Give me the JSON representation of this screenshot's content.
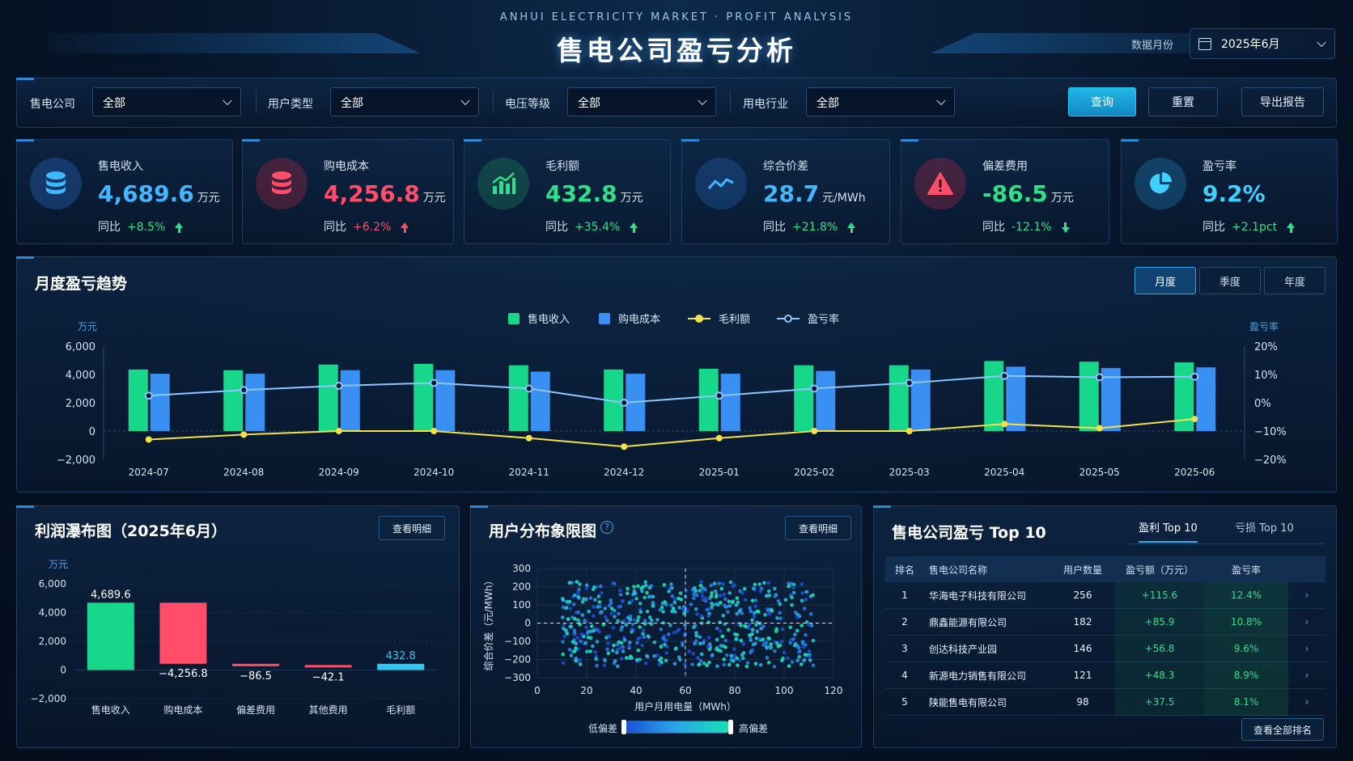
{
  "header": {
    "subtitle": "ANHUI ELECTRICITY MARKET · PROFIT ANALYSIS",
    "title": "售电公司盈亏分析",
    "month_label": "数据月份",
    "month_value": "2025年6月",
    "month_icon": "calendar-icon"
  },
  "filters": {
    "items": [
      {
        "label": "售电公司",
        "value": "全部"
      },
      {
        "label": "用户类型",
        "value": "全部"
      },
      {
        "label": "电压等级",
        "value": "全部"
      },
      {
        "label": "用电行业",
        "value": "全部"
      }
    ],
    "query": "查询",
    "reset": "重置",
    "export": "导出报告"
  },
  "kpis": [
    {
      "label": "售电收入",
      "value": "4,689.6",
      "unit": "万元",
      "yoy_label": "同比",
      "yoy": "+8.5%",
      "trend": "up",
      "color": "#3fb8ff",
      "icon": "database-icon"
    },
    {
      "label": "购电成本",
      "value": "4,256.8",
      "unit": "万元",
      "yoy_label": "同比",
      "yoy": "+6.2%",
      "trend": "up",
      "color": "#ff4d6a",
      "icon": "database-icon"
    },
    {
      "label": "毛利额",
      "value": "432.8",
      "unit": "万元",
      "yoy_label": "同比",
      "yoy": "+35.4%",
      "trend": "up",
      "color": "#2ee089",
      "icon": "bar-chart-icon"
    },
    {
      "label": "综合价差",
      "value": "28.7",
      "unit": "元/MWh",
      "yoy_label": "同比",
      "yoy": "+21.8%",
      "trend": "up",
      "color": "#3fb8ff",
      "icon": "trend-line-icon"
    },
    {
      "label": "偏差费用",
      "value": "-86.5",
      "unit": "万元",
      "yoy_label": "同比",
      "yoy": "-12.1%",
      "trend": "down",
      "color": "#2ee089",
      "icon": "warning-icon"
    },
    {
      "label": "盈亏率",
      "value": "9.2%",
      "unit": "",
      "yoy_label": "同比",
      "yoy": "+2.1pct",
      "trend": "up",
      "color": "#3fd0ff",
      "icon": "pie-chart-icon"
    }
  ],
  "trend_panel": {
    "title": "月度盈亏趋势",
    "tabs": [
      "月度",
      "季度",
      "年度"
    ],
    "active_tab": 0
  },
  "waterfall_panel": {
    "title": "利润瀑布图（2025年6月）",
    "detail_button": "查看明细"
  },
  "scatter_panel": {
    "title": "用户分布象限图",
    "help_icon": "help-circle-icon",
    "detail_button": "查看明细",
    "legend_low": "低偏差",
    "legend_high": "高偏差"
  },
  "ranking_panel": {
    "title": "售电公司盈亏 Top 10",
    "tabs": [
      "盈利 Top 10",
      "亏损 Top 10"
    ],
    "columns": [
      "排名",
      "售电公司名称",
      "用户数量",
      "盈亏额（万元）",
      "盈亏率"
    ],
    "rows": [
      {
        "rank": "1",
        "name": "华海电子科技有限公司",
        "users": "256",
        "amount": "+115.6",
        "rate": "12.4%"
      },
      {
        "rank": "2",
        "name": "鼎鑫能源有限公司",
        "users": "182",
        "amount": "+85.9",
        "rate": "10.8%"
      },
      {
        "rank": "3",
        "name": "创达科技产业园",
        "users": "146",
        "amount": "+56.8",
        "rate": "9.6%"
      },
      {
        "rank": "4",
        "name": "新源电力销售有限公司",
        "users": "121",
        "amount": "+48.3",
        "rate": "8.9%"
      },
      {
        "rank": "5",
        "name": "陕能售电有限公司",
        "users": "98",
        "amount": "+37.5",
        "rate": "8.1%"
      }
    ],
    "view_all": "查看全部排名"
  },
  "colors": {
    "revenue": "#17d88a",
    "cost": "#3a8ff2",
    "profit": "#f2e14b",
    "rate": "#8ec6ff",
    "negative": "#ff4d6a",
    "accent": "#29b0ec"
  },
  "chart_data": [
    {
      "type": "bar",
      "title": "月度盈亏趋势",
      "categories": [
        "2024-07",
        "2024-08",
        "2024-09",
        "2024-10",
        "2024-11",
        "2024-12",
        "2025-01",
        "2025-02",
        "2025-03",
        "2025-04",
        "2025-05",
        "2025-06"
      ],
      "series": [
        {
          "name": "售电收入",
          "kind": "bar",
          "axis": "left",
          "values": [
            4350,
            4300,
            4700,
            4750,
            4650,
            4350,
            4400,
            4650,
            4650,
            4950,
            4900,
            4850
          ]
        },
        {
          "name": "购电成本",
          "kind": "bar",
          "axis": "left",
          "values": [
            4050,
            4050,
            4300,
            4300,
            4200,
            4050,
            4050,
            4250,
            4350,
            4550,
            4450,
            4500
          ]
        },
        {
          "name": "毛利额",
          "kind": "line",
          "axis": "left",
          "values": [
            -600,
            -250,
            0,
            0,
            -500,
            -1100,
            -500,
            0,
            0,
            500,
            200,
            850
          ]
        },
        {
          "name": "盈亏率",
          "kind": "line",
          "axis": "right",
          "values": [
            2.5,
            4.5,
            6.0,
            7.0,
            5.0,
            0.0,
            2.5,
            5.0,
            7.0,
            9.5,
            9.0,
            9.2
          ]
        }
      ],
      "ylabel_left": "万元",
      "ylabel_right": "盈亏率",
      "ylim_left": [
        -2000,
        6000
      ],
      "yticks_left": [
        "6,000",
        "4,000",
        "2,000",
        "0",
        "−2,000"
      ],
      "ylim_right": [
        -20,
        20
      ],
      "yticks_right": [
        "20%",
        "10%",
        "0%",
        "−10%",
        "−20%"
      ],
      "legend": "top-center",
      "grid": false
    },
    {
      "type": "bar",
      "subtype": "waterfall",
      "title": "利润瀑布图（2025年6月）",
      "categories": [
        "售电收入",
        "购电成本",
        "偏差费用",
        "其他费用",
        "毛利额"
      ],
      "values": [
        4689.6,
        -4256.8,
        -86.5,
        -42.1,
        432.8
      ],
      "labels": [
        "4,689.6",
        "−4,256.8",
        "−86.5",
        "−42.1",
        "432.8"
      ],
      "ylabel": "万元",
      "ylim": [
        -2000,
        6000
      ],
      "yticks": [
        "6,000",
        "4,000",
        "2,000",
        "0",
        "−2,000"
      ],
      "grid": true
    },
    {
      "type": "scatter",
      "title": "用户分布象限图",
      "xlabel": "用户月用电量（MWh）",
      "ylabel": "综合价差（元/MWh）",
      "xlim": [
        0,
        120
      ],
      "ylim": [
        -300,
        300
      ],
      "xticks": [
        "0",
        "20",
        "40",
        "60",
        "80",
        "100",
        "120"
      ],
      "yticks": [
        "300",
        "200",
        "100",
        "0",
        "−100",
        "−200",
        "−300"
      ],
      "quadrant_x": 60,
      "quadrant_y": 0,
      "point_count": 600,
      "x_range": [
        10,
        112
      ],
      "y_range": [
        -240,
        230
      ],
      "color_scale": [
        "#1b4fd8",
        "#16e3b2"
      ]
    }
  ]
}
